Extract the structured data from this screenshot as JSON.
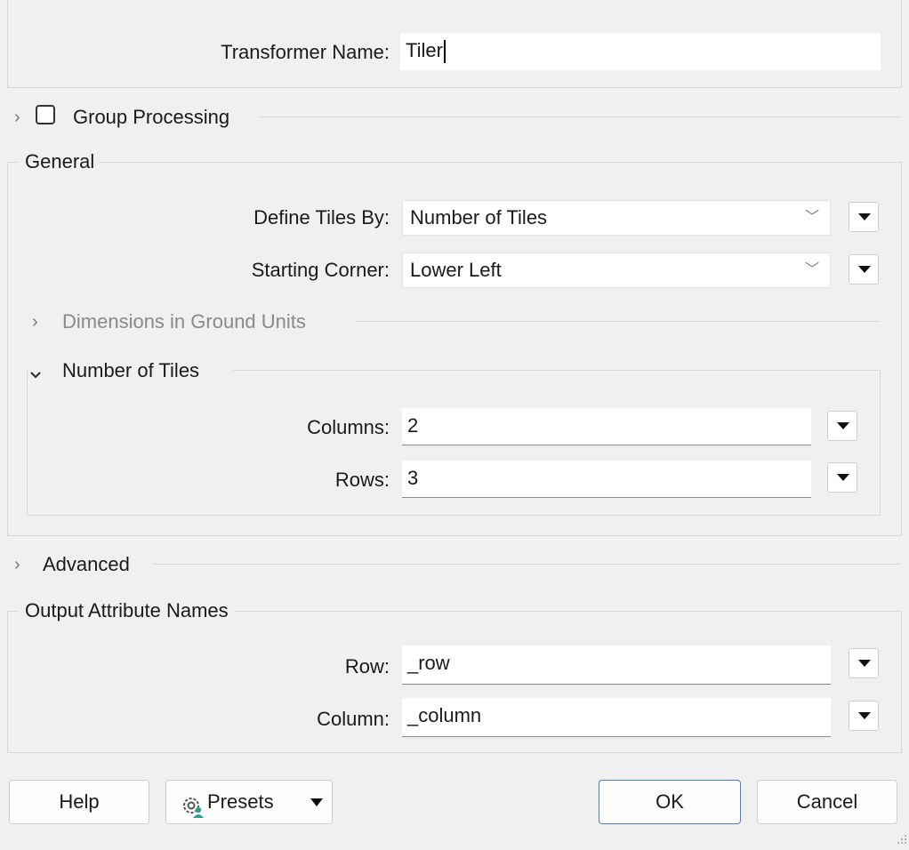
{
  "transformer": {
    "label": "Transformer Name:",
    "value": "Tiler"
  },
  "group_processing": {
    "label": "Group Processing",
    "checked": false
  },
  "general": {
    "title": "General",
    "define_tiles_by": {
      "label": "Define Tiles By:",
      "value": "Number of Tiles"
    },
    "starting_corner": {
      "label": "Starting Corner:",
      "value": "Lower Left"
    },
    "dimensions_section": {
      "title": "Dimensions in Ground Units",
      "expanded": false
    },
    "number_section": {
      "title": "Number of Tiles",
      "expanded": true,
      "columns": {
        "label": "Columns:",
        "value": "2"
      },
      "rows": {
        "label": "Rows:",
        "value": "3"
      }
    }
  },
  "advanced": {
    "title": "Advanced",
    "expanded": false
  },
  "output": {
    "title": "Output Attribute Names",
    "row": {
      "label": "Row:",
      "value": "_row"
    },
    "column": {
      "label": "Column:",
      "value": "_column"
    }
  },
  "buttons": {
    "help": "Help",
    "presets": "Presets",
    "ok": "OK",
    "cancel": "Cancel"
  },
  "icons": {
    "expand": "chevron-right-icon",
    "collapse": "chevron-down-icon",
    "menu": "triangle-down-icon",
    "presets": "gear-icon"
  },
  "colors": {
    "background": "#f0f0f0",
    "field": "#ffffff",
    "primary_border": "#4a7dd1"
  }
}
